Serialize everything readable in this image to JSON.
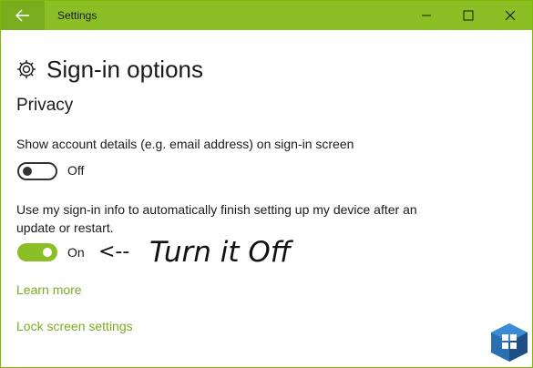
{
  "window": {
    "title": "Settings",
    "accent": "#8cbf26",
    "back_icon": "arrow-left-icon",
    "controls": [
      "minimize-icon",
      "maximize-icon",
      "close-icon"
    ]
  },
  "page": {
    "title": "Sign-in options",
    "icon": "gear-icon"
  },
  "privacy": {
    "heading": "Privacy",
    "setting1": {
      "label": "Show account details (e.g. email address) on sign-in screen",
      "state": "Off"
    },
    "setting2": {
      "label": "Use my sign-in info to automatically finish setting up my device after an update or restart.",
      "state": "On"
    }
  },
  "annotation": {
    "arrow": "<--",
    "text": "Turn it Off"
  },
  "links": {
    "learn_more": "Learn more",
    "lock_screen": "Lock screen settings"
  },
  "watermark": {
    "icon": "windows-logo-icon"
  }
}
